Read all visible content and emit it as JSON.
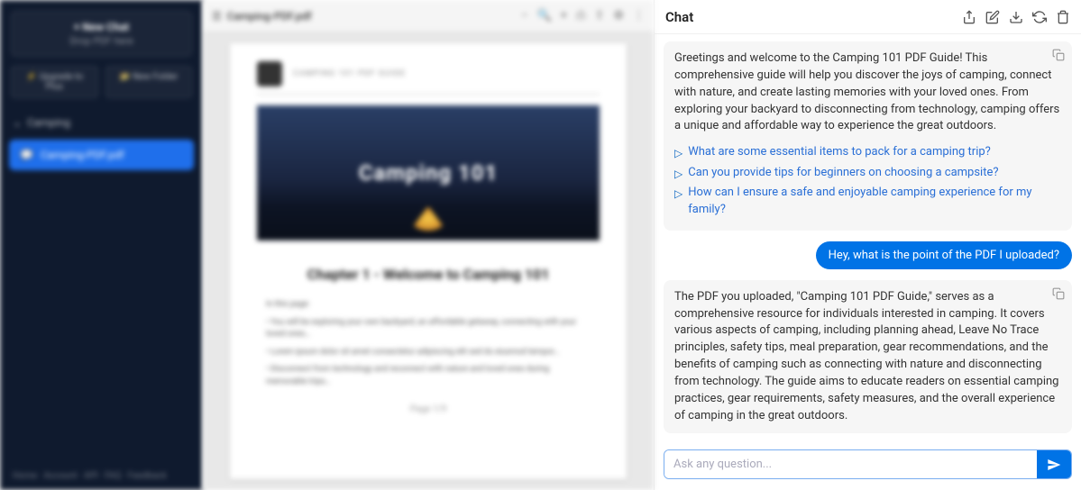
{
  "sidebar": {
    "new_chat_title": "+ New Chat",
    "new_chat_sub": "Drop PDF here",
    "upgrade_label": "⚡ Upgrade to Plus",
    "folder_label": "📁 New Folder",
    "section_label": "Camping",
    "file_label": "Camping-PDF.pdf",
    "footer": "Home · Account · API · FAQ · Feedback"
  },
  "viewer": {
    "filename": "Camping-PDF.pdf",
    "hero_title": "Camping 101",
    "chapter_title": "Chapter 1 - Welcome to Camping 101",
    "page_indicator": "Page 1/9"
  },
  "chat": {
    "title": "Chat",
    "greeting": "Greetings and welcome to the Camping 101 PDF Guide! This comprehensive guide will help you discover the joys of camping, connect with nature, and create lasting memories with your loved ones. From exploring your backyard to disconnecting from technology, camping offers a unique and affordable way to experience the great outdoors.",
    "suggestions": [
      "What are some essential items to pack for a camping trip?",
      "Can you provide tips for beginners on choosing a campsite?",
      "How can I ensure a safe and enjoyable camping experience for my family?"
    ],
    "user_message": "Hey, what is the point of the PDF I uploaded?",
    "ai_response": "The PDF you uploaded, \"Camping 101 PDF Guide,\" serves as a comprehensive resource for individuals interested in camping. It covers various aspects of camping, including planning ahead, Leave No Trace principles, safety tips, meal preparation, gear recommendations, and the benefits of camping such as connecting with nature and disconnecting from technology. The guide aims to educate readers on essential camping practices, gear requirements, safety measures, and the overall experience of camping in the great outdoors.",
    "input_placeholder": "Ask any question..."
  }
}
